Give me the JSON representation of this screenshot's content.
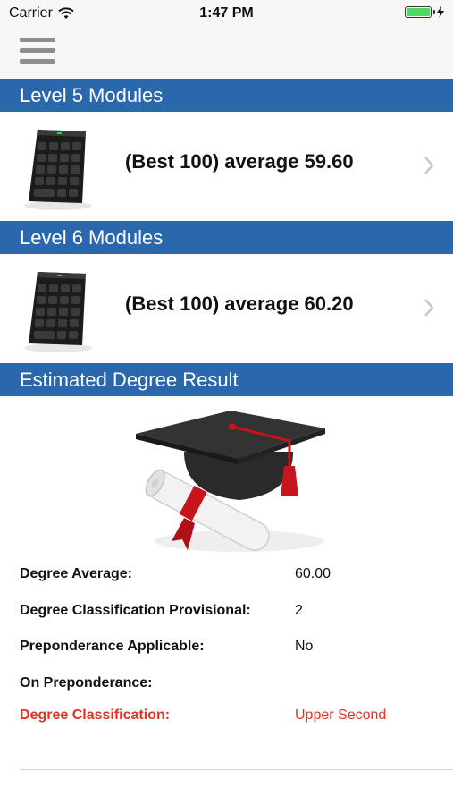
{
  "status_bar": {
    "carrier": "Carrier",
    "time": "1:47 PM"
  },
  "sections": {
    "level5": {
      "title": "Level 5 Modules",
      "row_label": "(Best 100) average 59.60"
    },
    "level6": {
      "title": "Level 6 Modules",
      "row_label": "(Best 100) average 60.20"
    },
    "estimate": {
      "title": "Estimated Degree Result"
    }
  },
  "results": [
    {
      "label": "Degree Average:",
      "value": "60.00"
    },
    {
      "label": "Degree Classification Provisional:",
      "value": "2"
    },
    {
      "label": "Preponderance Applicable:",
      "value": "No"
    },
    {
      "label": "On Preponderance:",
      "value": ""
    },
    {
      "label": "Degree Classification:",
      "value": "Upper Second"
    }
  ],
  "icons": {
    "menu": "hamburger-menu-icon",
    "row_chevron": "chevron-right-icon",
    "module_image": "keypad-icon",
    "degree_image": "graduation-cap-icon"
  },
  "colors": {
    "header_bar": "#2a67ad",
    "highlight": "#e53224",
    "battery": "#4cd964"
  }
}
